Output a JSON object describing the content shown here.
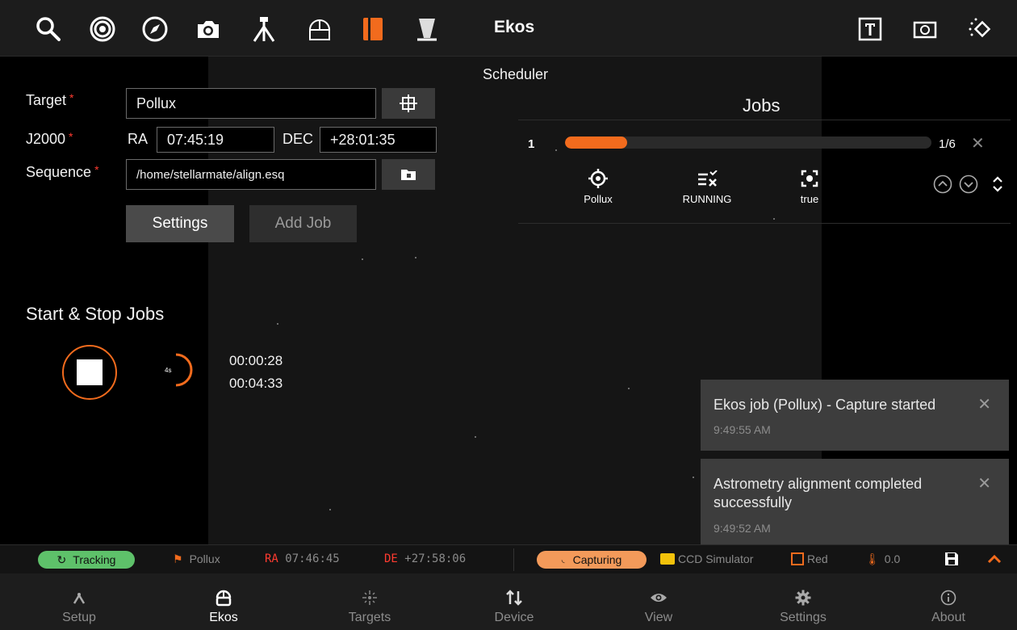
{
  "app": {
    "title": "Ekos",
    "toolbar_icons": [
      "search-icon",
      "target-icon",
      "compass-icon",
      "camera-icon",
      "tripod-icon",
      "observatory-icon",
      "scheduler-icon",
      "telescope-cover-icon"
    ],
    "right_icons": [
      "text-frame-icon",
      "screenshot-icon",
      "rotate-icon"
    ]
  },
  "scheduler": {
    "title": "Scheduler",
    "target_label": "Target",
    "target_value": "Pollux",
    "j2000_label": "J2000",
    "ra_label": "RA",
    "ra_value": "07:45:19",
    "dec_label": "DEC",
    "dec_value": "+28:01:35",
    "sequence_label": "Sequence",
    "sequence_value": "/home/stellarmate/align.esq",
    "settings_button": "Settings",
    "add_job_button": "Add Job"
  },
  "jobs": {
    "title": "Jobs",
    "items": [
      {
        "index": "1",
        "progress_fraction": 0.17,
        "count": "1/6",
        "target": "Pollux",
        "state": "RUNNING",
        "flag": "true"
      }
    ]
  },
  "start_stop": {
    "title": "Start & Stop Jobs",
    "countdown_label": "4s",
    "elapsed": "00:00:28",
    "remaining": "00:04:33"
  },
  "notifications": [
    {
      "message": "Ekos job (Pollux) - Capture started",
      "time": "9:49:55 AM"
    },
    {
      "message": "Astrometry alignment completed successfully",
      "time": "9:49:52 AM"
    }
  ],
  "status": {
    "tracking": "Tracking",
    "target": "Pollux",
    "ra_label": "RA",
    "ra_value": "07:46:45",
    "de_label": "DE",
    "de_value": "+27:58:06",
    "capture_state": "Capturing",
    "camera": "CCD Simulator",
    "filter": "Red",
    "temperature": "0.0"
  },
  "nav": {
    "items": [
      {
        "label": "Setup",
        "icon": "setup-icon"
      },
      {
        "label": "Ekos",
        "icon": "ekos-icon"
      },
      {
        "label": "Targets",
        "icon": "targets-icon"
      },
      {
        "label": "Device",
        "icon": "device-icon"
      },
      {
        "label": "View",
        "icon": "view-icon"
      },
      {
        "label": "Settings",
        "icon": "settings-gear-icon"
      },
      {
        "label": "About",
        "icon": "about-icon"
      }
    ],
    "active": "Ekos"
  },
  "colors": {
    "accent": "#f26b1d",
    "tracking_green": "#5ec16a",
    "capturing_orange": "#f39a5a",
    "status_red": "#ff3b30"
  }
}
